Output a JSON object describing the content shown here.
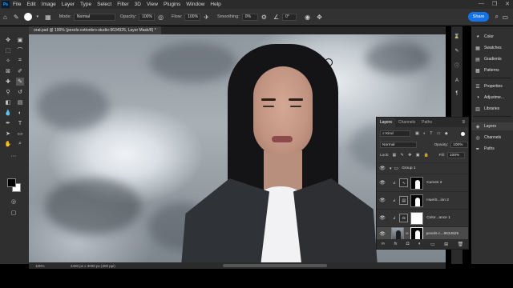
{
  "app": {
    "logo": "Ps"
  },
  "menu": [
    "File",
    "Edit",
    "Image",
    "Layer",
    "Type",
    "Select",
    "Filter",
    "3D",
    "View",
    "Plugins",
    "Window",
    "Help"
  ],
  "window_controls": [
    "—",
    "❐",
    "✕"
  ],
  "options": {
    "mode_label": "Mode:",
    "mode_value": "Normal",
    "opacity_label": "Opacity:",
    "opacity_value": "100%",
    "flow_label": "Flow:",
    "flow_value": "100%",
    "smoothing_label": "Smoothing:",
    "smoothing_value": "0%",
    "angle_value": "0°",
    "share_label": "Share"
  },
  "document": {
    "tab_title": "orat.psd @ 100% (pexels-cottonbro-studio-9634925, Layer Mask/8) *",
    "zoom": "100%",
    "dimensions": "2400 px x 3000 px (300 ppi)"
  },
  "right_panels": {
    "group1": [
      "Color",
      "Swatches",
      "Gradients",
      "Patterns"
    ],
    "group2": [
      "Properties",
      "Adjustme...",
      "Libraries"
    ],
    "group3": [
      "Layers",
      "Channels",
      "Paths"
    ]
  },
  "layers_panel": {
    "tabs": [
      "Layers",
      "Channels",
      "Paths"
    ],
    "kind_label": "Kind",
    "blend_mode": "Normal",
    "opacity_label": "Opacity:",
    "opacity_value": "100%",
    "lock_label": "Lock:",
    "fill_label": "Fill:",
    "fill_value": "100%",
    "layers": [
      {
        "name": "Group 1",
        "type": "group"
      },
      {
        "name": "Curves 2",
        "type": "curves"
      },
      {
        "name": "Hue/S...ion 2",
        "type": "hue"
      },
      {
        "name": "Color...ance 1",
        "type": "balance"
      },
      {
        "name": "pexels-c...9634925",
        "type": "image"
      }
    ],
    "footer_icons": [
      "link-icon",
      "fx-icon",
      "mask-icon",
      "adjustment-icon",
      "folder-icon",
      "new-layer-icon",
      "trash-icon"
    ]
  }
}
